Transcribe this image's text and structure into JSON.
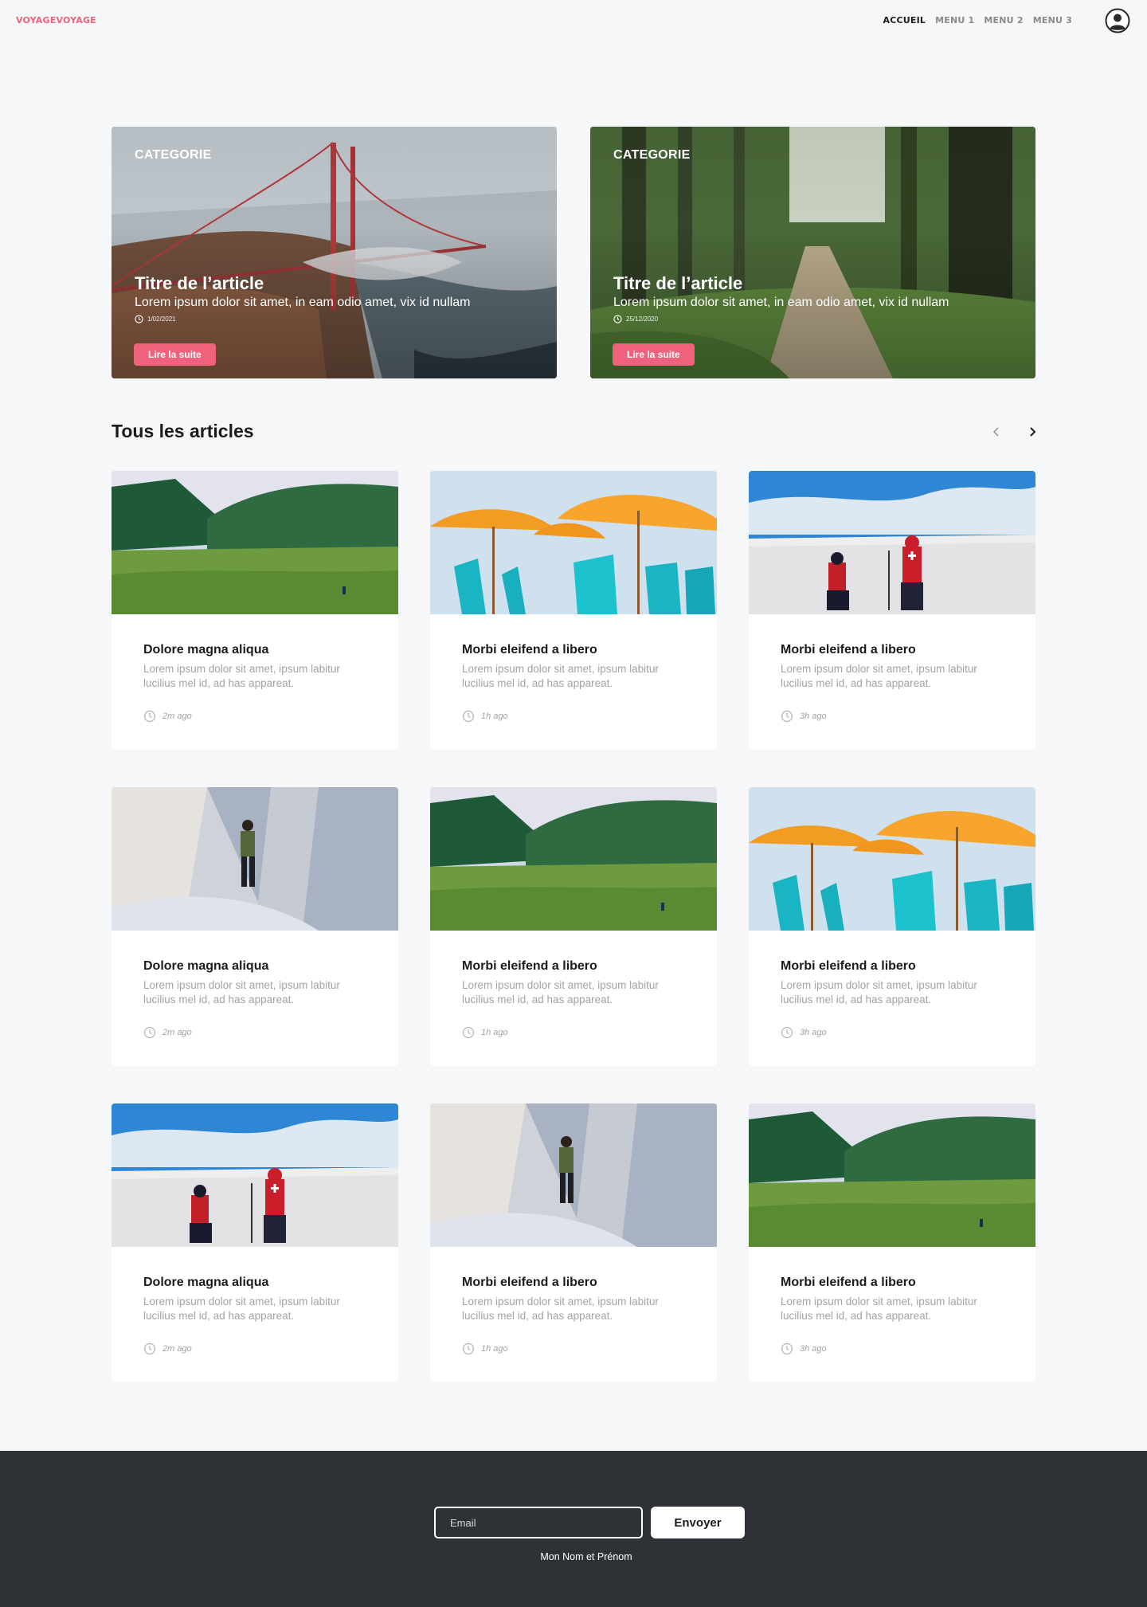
{
  "header": {
    "brand": "VOYAGEVOYAGE",
    "nav": [
      {
        "label": "ACCUEIL",
        "active": true
      },
      {
        "label": "MENU 1",
        "active": false
      },
      {
        "label": "MENU 2",
        "active": false
      },
      {
        "label": "MENU 3",
        "active": false
      }
    ],
    "account_icon": "user-circle-icon"
  },
  "featured": [
    {
      "category": "CATEGORIE",
      "title": "Titre de l’article",
      "description": "Lorem ipsum dolor sit amet, in eam odio amet, vix id nullam",
      "date": "1/02/2021",
      "button": "Lire la suite",
      "image": "golden-gate-bridge-fog"
    },
    {
      "category": "CATEGORIE",
      "title": "Titre de l’article",
      "description": "Lorem ipsum dolor sit amet, in eam odio amet, vix id nullam",
      "date": "25/12/2020",
      "button": "Lire la suite",
      "image": "forest-path"
    }
  ],
  "articles": {
    "title": "Tous les articles",
    "prev_icon": "chevron-left-icon",
    "next_icon": "chevron-right-icon",
    "cards": [
      {
        "title": "Dolore magna aliqua",
        "description": "Lorem ipsum dolor sit amet, ipsum labitur lucilius mel id, ad has appareat.",
        "time": "2m ago",
        "image": "green-valley"
      },
      {
        "title": "Morbi eleifend a libero",
        "description": "Lorem ipsum dolor sit amet, ipsum labitur lucilius mel id, ad has appareat.",
        "time": "1h ago",
        "image": "beach-umbrellas"
      },
      {
        "title": "Morbi eleifend a libero",
        "description": "Lorem ipsum dolor sit amet, ipsum labitur lucilius mel id, ad has appareat.",
        "time": "3h ago",
        "image": "snow-hikers"
      },
      {
        "title": "Dolore magna aliqua",
        "description": "Lorem ipsum dolor sit amet, ipsum labitur lucilius mel id, ad has appareat.",
        "time": "2m ago",
        "image": "rock-climber"
      },
      {
        "title": "Morbi eleifend a libero",
        "description": "Lorem ipsum dolor sit amet, ipsum labitur lucilius mel id, ad has appareat.",
        "time": "1h ago",
        "image": "green-valley"
      },
      {
        "title": "Morbi eleifend a libero",
        "description": "Lorem ipsum dolor sit amet, ipsum labitur lucilius mel id, ad has appareat.",
        "time": "3h ago",
        "image": "beach-umbrellas"
      },
      {
        "title": "Dolore magna aliqua",
        "description": "Lorem ipsum dolor sit amet, ipsum labitur lucilius mel id, ad has appareat.",
        "time": "2m ago",
        "image": "snow-hikers"
      },
      {
        "title": "Morbi eleifend a libero",
        "description": "Lorem ipsum dolor sit amet, ipsum labitur lucilius mel id, ad has appareat.",
        "time": "1h ago",
        "image": "rock-climber"
      },
      {
        "title": "Morbi eleifend a libero",
        "description": "Lorem ipsum dolor sit amet, ipsum labitur lucilius mel id, ad has appareat.",
        "time": "3h ago",
        "image": "green-valley"
      }
    ]
  },
  "footer": {
    "email_placeholder": "Email",
    "send_label": "Envoyer",
    "signature": "Mon Nom et Prénom"
  },
  "colors": {
    "accent": "#f0627b",
    "background": "#f5f7f9",
    "footer": "#2e3136"
  }
}
